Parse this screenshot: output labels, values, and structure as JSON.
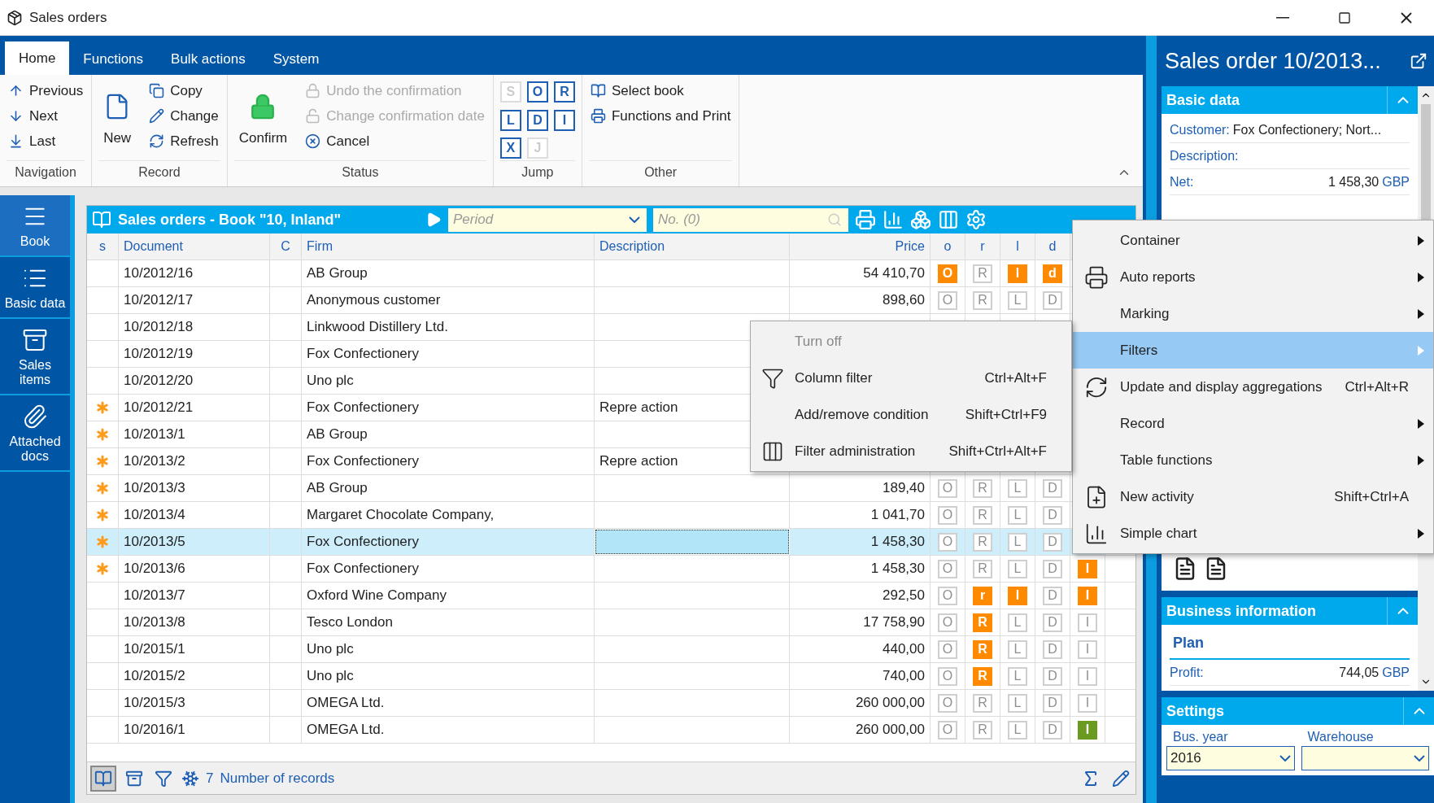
{
  "window": {
    "title": "Sales orders"
  },
  "ribbon": {
    "tabs": [
      {
        "label": "Home",
        "selected": true
      },
      {
        "label": "Functions",
        "selected": false
      },
      {
        "label": "Bulk actions",
        "selected": false
      },
      {
        "label": "System",
        "selected": false
      }
    ],
    "groups": [
      {
        "label": "Navigation",
        "kind": "list",
        "items": [
          {
            "label": "Previous",
            "disabled": false
          },
          {
            "label": "Next",
            "disabled": false
          },
          {
            "label": "Last",
            "disabled": false
          }
        ]
      },
      {
        "label": "Record",
        "kind": "mixed",
        "large": "New",
        "items": [
          {
            "label": "Copy",
            "disabled": false
          },
          {
            "label": "Change",
            "disabled": false
          },
          {
            "label": "Refresh",
            "disabled": false
          }
        ]
      },
      {
        "label": "Status",
        "kind": "mixed",
        "large": "Confirm",
        "items": [
          {
            "label": "Undo the confirmation",
            "disabled": true
          },
          {
            "label": "Change confirmation date",
            "disabled": true
          },
          {
            "label": "Cancel",
            "disabled": false
          }
        ]
      },
      {
        "label": "Jump",
        "kind": "letters",
        "items": [
          {
            "label": "S",
            "disabled": true
          },
          {
            "label": "O",
            "disabled": false
          },
          {
            "label": "R",
            "disabled": false
          },
          {
            "label": "L",
            "disabled": false
          },
          {
            "label": "D",
            "disabled": false
          },
          {
            "label": "I",
            "disabled": false
          },
          {
            "label": "X",
            "disabled": false
          },
          {
            "label": "J",
            "disabled": true
          }
        ]
      },
      {
        "label": "Other",
        "kind": "list",
        "items": [
          {
            "label": "Select book",
            "disabled": false
          },
          {
            "label": "Functions and Print",
            "disabled": false
          }
        ]
      }
    ]
  },
  "sidebar": {
    "items": [
      {
        "label": "Book",
        "selected": true
      },
      {
        "label": "Basic data",
        "selected": false
      },
      {
        "label": "Sales items",
        "selected": false
      },
      {
        "label": "Attached docs",
        "selected": false
      }
    ]
  },
  "table": {
    "title": "Sales orders - Book \"10, Inland\"",
    "period": {
      "placeholder": "Period"
    },
    "number": {
      "placeholder": "No. (0)"
    },
    "columns": [
      "s",
      "Document",
      "C",
      "Firm",
      "Description",
      "Price",
      "o",
      "r",
      "l",
      "d"
    ],
    "rows": [
      {
        "starred": false,
        "selected": false,
        "document": "10/2012/16",
        "firm": "AB Group",
        "price": "54 410,70",
        "flags": [
          {
            "letter": "O",
            "on": true,
            "color": "#ff8a00"
          },
          {
            "letter": "R",
            "on": false
          },
          {
            "letter": "l",
            "on": true,
            "color": "#ff8a00"
          },
          {
            "letter": "d",
            "on": true,
            "color": "#ff8a00"
          }
        ]
      },
      {
        "starred": false,
        "selected": false,
        "document": "10/2012/17",
        "firm": "Anonymous customer",
        "price": "898,60",
        "flags": [
          {
            "letter": "O",
            "on": false
          },
          {
            "letter": "R",
            "on": false
          },
          {
            "letter": "L",
            "on": false
          },
          {
            "letter": "D",
            "on": false
          }
        ]
      },
      {
        "starred": false,
        "selected": false,
        "document": "10/2012/18",
        "firm": "Linkwood Distillery Ltd."
      },
      {
        "starred": false,
        "selected": false,
        "document": "10/2012/19",
        "firm": "Fox Confectionery"
      },
      {
        "starred": false,
        "selected": false,
        "document": "10/2012/20",
        "firm": "Uno plc"
      },
      {
        "starred": true,
        "selected": false,
        "document": "10/2012/21",
        "firm": "Fox Confectionery",
        "description": "Repre action"
      },
      {
        "starred": true,
        "selected": false,
        "document": "10/2013/1",
        "firm": "AB Group"
      },
      {
        "starred": true,
        "selected": false,
        "document": "10/2013/2",
        "firm": "Fox Confectionery",
        "description": "Repre action"
      },
      {
        "starred": true,
        "selected": false,
        "document": "10/2013/3",
        "firm": "AB Group",
        "price": "189,40",
        "flags": [
          {
            "letter": "O",
            "on": false
          },
          {
            "letter": "R",
            "on": false
          },
          {
            "letter": "L",
            "on": false
          },
          {
            "letter": "D",
            "on": false
          }
        ]
      },
      {
        "starred": true,
        "selected": false,
        "document": "10/2013/4",
        "firm": "Margaret Chocolate Company,",
        "price": "1 041,70",
        "flags": [
          {
            "letter": "O",
            "on": false
          },
          {
            "letter": "R",
            "on": false
          },
          {
            "letter": "L",
            "on": false
          },
          {
            "letter": "D",
            "on": false
          }
        ]
      },
      {
        "starred": true,
        "selected": true,
        "document": "10/2013/5",
        "firm": "Fox Confectionery",
        "price": "1 458,30",
        "flags": [
          {
            "letter": "O",
            "on": false
          },
          {
            "letter": "R",
            "on": false
          },
          {
            "letter": "L",
            "on": false
          },
          {
            "letter": "D",
            "on": false
          }
        ]
      },
      {
        "starred": true,
        "selected": false,
        "document": "10/2013/6",
        "firm": "Fox Confectionery",
        "price": "1 458,30",
        "flags": [
          {
            "letter": "O",
            "on": false
          },
          {
            "letter": "R",
            "on": false
          },
          {
            "letter": "L",
            "on": false
          },
          {
            "letter": "D",
            "on": false
          },
          {
            "letter": "I",
            "on": true,
            "color": "#ff8a00"
          }
        ]
      },
      {
        "starred": false,
        "selected": false,
        "document": "10/2013/7",
        "firm": "Oxford Wine Company",
        "price": "292,50",
        "flags": [
          {
            "letter": "O",
            "on": false
          },
          {
            "letter": "r",
            "on": true,
            "color": "#ff8a00"
          },
          {
            "letter": "l",
            "on": true,
            "color": "#ff8a00"
          },
          {
            "letter": "D",
            "on": false
          },
          {
            "letter": "I",
            "on": true,
            "color": "#ff8a00"
          }
        ]
      },
      {
        "starred": false,
        "selected": false,
        "document": "10/2013/8",
        "firm": "Tesco London",
        "price": "17 758,90",
        "flags": [
          {
            "letter": "O",
            "on": false
          },
          {
            "letter": "R",
            "on": true,
            "color": "#ff8a00"
          },
          {
            "letter": "L",
            "on": false
          },
          {
            "letter": "D",
            "on": false
          },
          {
            "letter": "I",
            "on": false
          }
        ]
      },
      {
        "starred": false,
        "selected": false,
        "document": "10/2015/1",
        "firm": "Uno plc",
        "price": "440,00",
        "flags": [
          {
            "letter": "O",
            "on": false
          },
          {
            "letter": "R",
            "on": true,
            "color": "#ff8a00"
          },
          {
            "letter": "L",
            "on": false
          },
          {
            "letter": "D",
            "on": false
          },
          {
            "letter": "I",
            "on": false
          }
        ]
      },
      {
        "starred": false,
        "selected": false,
        "document": "10/2015/2",
        "firm": "Uno plc",
        "price": "740,00",
        "flags": [
          {
            "letter": "O",
            "on": false
          },
          {
            "letter": "R",
            "on": true,
            "color": "#ff8a00"
          },
          {
            "letter": "L",
            "on": false
          },
          {
            "letter": "D",
            "on": false
          },
          {
            "letter": "I",
            "on": false
          }
        ]
      },
      {
        "starred": false,
        "selected": false,
        "document": "10/2015/3",
        "firm": "OMEGA Ltd.",
        "price": "260 000,00",
        "flags": [
          {
            "letter": "O",
            "on": false
          },
          {
            "letter": "R",
            "on": false
          },
          {
            "letter": "L",
            "on": false
          },
          {
            "letter": "D",
            "on": false
          },
          {
            "letter": "I",
            "on": false
          }
        ]
      },
      {
        "starred": false,
        "selected": false,
        "document": "10/2016/1",
        "firm": "OMEGA Ltd.",
        "price": "260 000,00",
        "flags": [
          {
            "letter": "O",
            "on": false
          },
          {
            "letter": "R",
            "on": false
          },
          {
            "letter": "L",
            "on": false
          },
          {
            "letter": "D",
            "on": false
          },
          {
            "letter": "I",
            "on": true,
            "color": "#6a9a1f"
          }
        ]
      }
    ],
    "footer": {
      "count": "7",
      "label": "Number of records"
    }
  },
  "detail": {
    "title": "Sales order 10/2013...",
    "basic_data": {
      "title": "Basic data",
      "expanded": true,
      "fields": [
        {
          "label": "Customer:",
          "value": "Fox Confectionery; Nort..."
        },
        {
          "label": "Description:"
        },
        {
          "label": "Net:",
          "value": "1 458,30",
          "unit": "GBP"
        }
      ]
    },
    "business_information": {
      "title": "Business information",
      "expanded": true,
      "subtitle": "Plan",
      "fields": [
        {
          "label": "Profit:",
          "value": "744,05",
          "unit": "GBP"
        }
      ]
    },
    "settings": {
      "title": "Settings",
      "expanded": true,
      "fields": [
        {
          "label": "Bus. year",
          "value": "2016"
        },
        {
          "label": "Warehouse"
        }
      ]
    }
  },
  "context_menu": {
    "items": [
      {
        "label": "Container",
        "submenu": true,
        "selected": false
      },
      {
        "label": "Auto reports",
        "submenu": true,
        "selected": false
      },
      {
        "label": "Marking",
        "submenu": true,
        "selected": false
      },
      {
        "label": "Filters",
        "submenu": true,
        "selected": true
      },
      {
        "label": "Update and display aggregations",
        "shortcut": "Ctrl+Alt+R",
        "submenu": false,
        "selected": false
      },
      {
        "label": "Record",
        "submenu": true,
        "selected": false
      },
      {
        "label": "Table functions",
        "submenu": true,
        "selected": false
      },
      {
        "label": "New activity",
        "shortcut": "Shift+Ctrl+A",
        "submenu": false,
        "selected": false
      },
      {
        "label": "Simple chart",
        "submenu": true,
        "selected": false
      }
    ]
  },
  "filters_submenu": {
    "items": [
      {
        "label": "Turn off",
        "disabled": true
      },
      {
        "label": "Column filter",
        "shortcut": "Ctrl+Alt+F",
        "disabled": false
      },
      {
        "label": "Add/remove condition",
        "shortcut": "Shift+Ctrl+F9",
        "disabled": false
      },
      {
        "label": "Filter administration",
        "shortcut": "Shift+Ctrl+Alt+F",
        "disabled": false
      }
    ]
  }
}
